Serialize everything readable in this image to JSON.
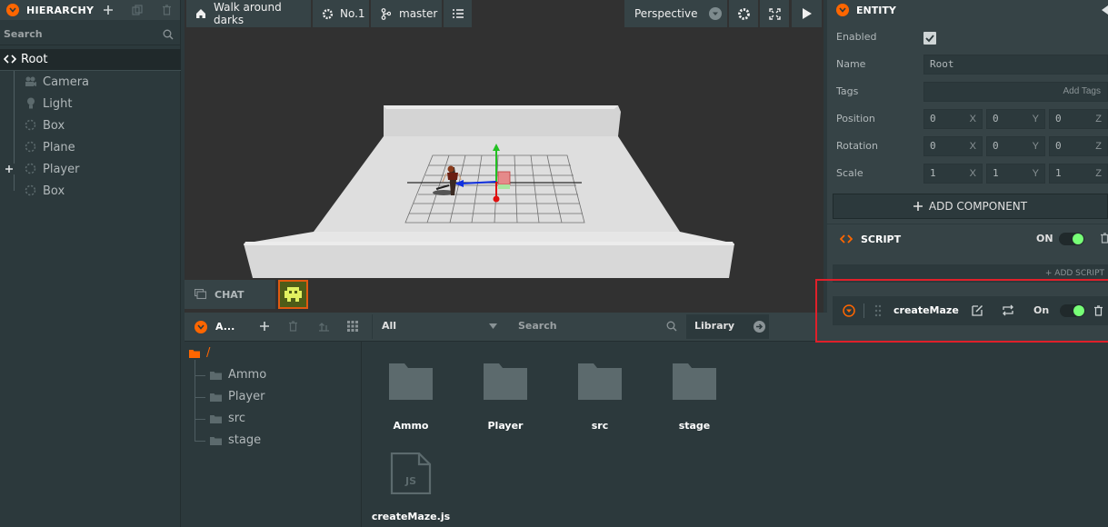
{
  "hierarchy": {
    "title": "HIERARCHY",
    "search_placeholder": "Search",
    "root": "Root",
    "items": [
      "Camera",
      "Light",
      "Box",
      "Plane",
      "Player",
      "Box"
    ]
  },
  "toolbar": {
    "project": "Walk around darks",
    "scene": "No.1",
    "branch": "master",
    "camera": "Perspective"
  },
  "chat": {
    "label": "CHAT"
  },
  "assets": {
    "title": "A...",
    "filter": "All",
    "search": "Search",
    "library": "Library",
    "root_folder": "/",
    "folders": [
      "Ammo",
      "Player",
      "src",
      "stage"
    ],
    "files": [
      "Ammo",
      "Player",
      "src",
      "stage",
      "createMaze.js"
    ],
    "js_badge": "JS"
  },
  "entity": {
    "title": "ENTITY",
    "enabled_label": "Enabled",
    "enabled": true,
    "name_label": "Name",
    "name_value": "Root",
    "tags_label": "Tags",
    "add_tags": "Add Tags",
    "position_label": "Position",
    "position": [
      "0",
      "0",
      "0"
    ],
    "rotation_label": "Rotation",
    "rotation": [
      "0",
      "0",
      "0"
    ],
    "scale_label": "Scale",
    "scale": [
      "1",
      "1",
      "1"
    ],
    "axes": [
      "X",
      "Y",
      "Z"
    ],
    "add_component": "ADD COMPONENT"
  },
  "script": {
    "title": "SCRIPT",
    "on_label": "ON",
    "add_script": "+ ADD SCRIPT",
    "script_name": "createMaze",
    "script_on": "On"
  },
  "colors": {
    "accent": "#ff6600",
    "highlight": "#e0202a",
    "toggle_on": "#77ff77"
  }
}
